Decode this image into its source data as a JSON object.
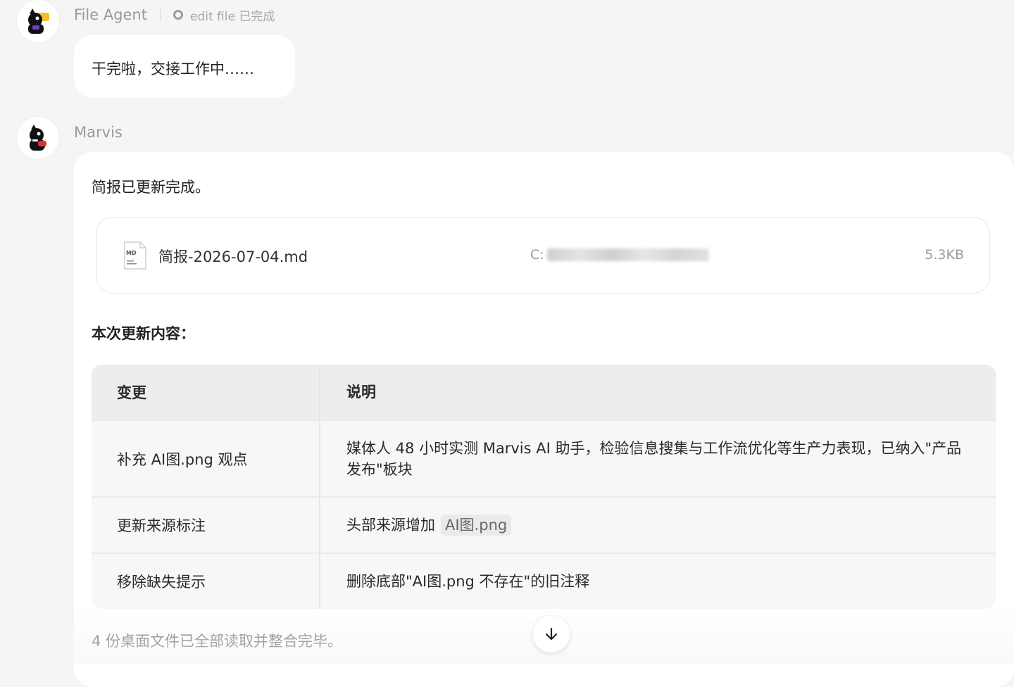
{
  "file_agent": {
    "name": "File Agent",
    "status": "edit file 已完成",
    "message": "干完啦，交接工作中……"
  },
  "marvis": {
    "name": "Marvis",
    "intro": "简报已更新完成。",
    "file": {
      "name": "简报-2026-07-04.md",
      "path_prefix": "C:",
      "size": "5.3KB",
      "icon_label": "MD"
    },
    "section_title": "本次更新内容：",
    "table": {
      "headers": [
        "变更",
        "说明"
      ],
      "rows": [
        {
          "change": "补充 AI图.png 观点",
          "desc": "媒体人 48 小时实测 Marvis AI 助手，检验信息搜集与工作流优化等生产力表现，已纳入\"产品发布\"板块"
        },
        {
          "change": "更新来源标注",
          "desc": "头部来源增加",
          "code": "AI图.png"
        },
        {
          "change": "移除缺失提示",
          "desc": "删除底部\"AI图.png 不存在\"的旧注释"
        }
      ]
    },
    "footer": "4 份桌面文件已全部读取并整合完毕。"
  },
  "icons": {
    "status": "circle-status-icon",
    "file": "md-file-icon",
    "scroll": "arrow-down-icon"
  }
}
